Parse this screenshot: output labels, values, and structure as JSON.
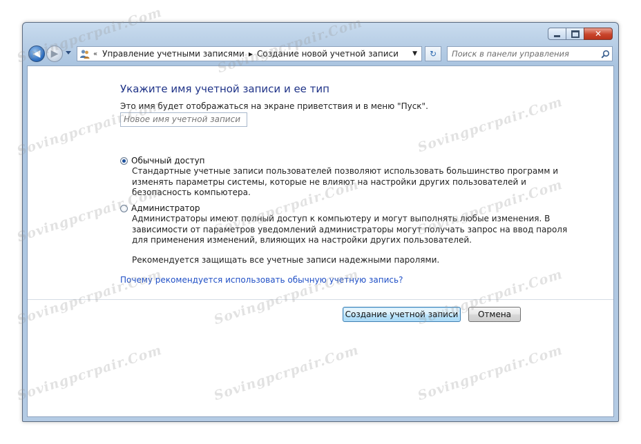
{
  "window": {
    "caption_buttons": {
      "close_glyph": "✕"
    }
  },
  "nav": {
    "back_glyph": "◀",
    "forward_glyph": "▶",
    "address": {
      "icon": "user-accounts-icon",
      "separator": "«",
      "crumbs": [
        "Управление учетными записями",
        "Создание новой учетной записи"
      ],
      "crumb_arrow": "▶",
      "dropdown_glyph": "▼"
    },
    "refresh_glyph": "↻",
    "search": {
      "placeholder": "Поиск в панели управления"
    }
  },
  "main": {
    "heading": "Укажите имя учетной записи и ее тип",
    "description": "Это имя будет отображаться на экране приветствия и в меню \"Пуск\".",
    "name_input": {
      "placeholder": "Новое имя учетной записи",
      "value": ""
    },
    "options": [
      {
        "label": "Обычный доступ",
        "selected": true,
        "description_lines": [
          "Стандартные учетные записи пользователей позволяют использовать большинство программ и",
          "изменять параметры системы, которые не влияют на настройки других пользователей и",
          "безопасность компьютера."
        ]
      },
      {
        "label": "Администратор",
        "selected": false,
        "description_lines": [
          "Администраторы имеют полный доступ к компьютеру и могут выполнять любые изменения. В",
          "зависимости от параметров уведомлений администраторы могут получать запрос на ввод пароля",
          "для применения изменений, влияющих на настройки других пользователей."
        ]
      }
    ],
    "recommendation": "Рекомендуется защищать все учетные записи надежными паролями.",
    "help_link": "Почему рекомендуется использовать обычную учетную запись?"
  },
  "buttons": {
    "create": "Создание учетной записи",
    "cancel": "Отмена"
  },
  "watermark": {
    "text": "Sovingpcrpair.Com"
  }
}
